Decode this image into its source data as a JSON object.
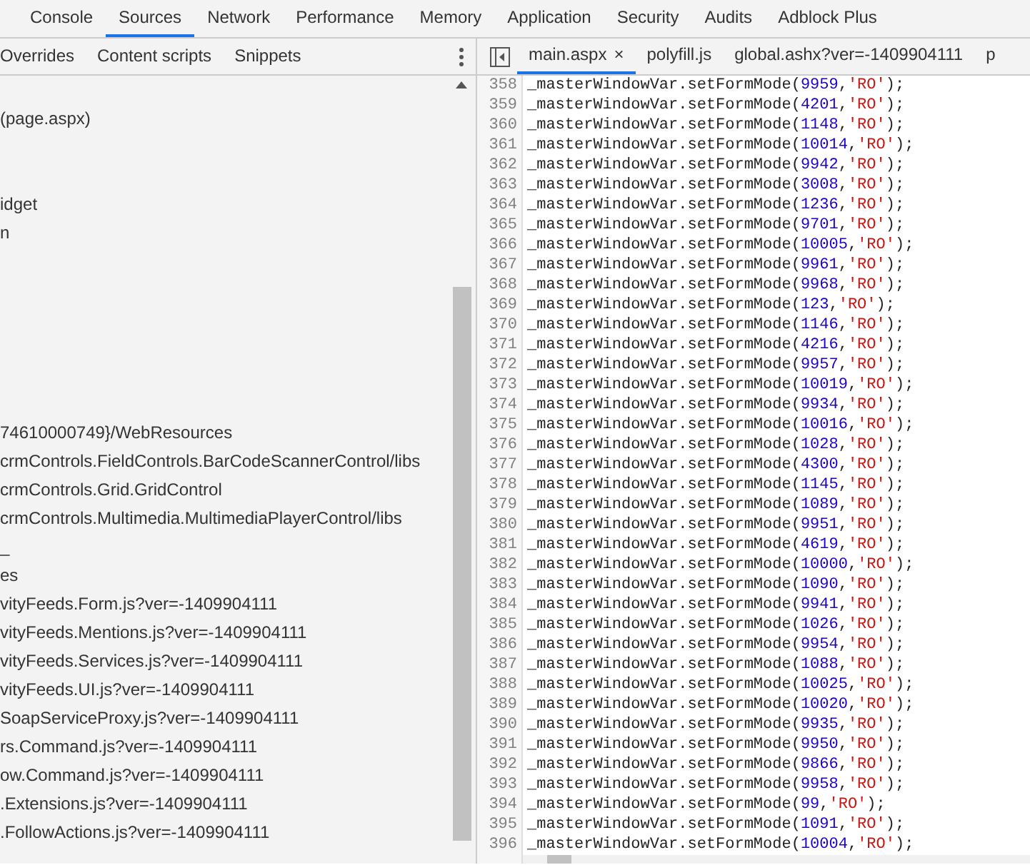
{
  "main_tabs": [
    {
      "label": "Console",
      "selected": false
    },
    {
      "label": "Sources",
      "selected": true
    },
    {
      "label": "Network",
      "selected": false
    },
    {
      "label": "Performance",
      "selected": false
    },
    {
      "label": "Memory",
      "selected": false
    },
    {
      "label": "Application",
      "selected": false
    },
    {
      "label": "Security",
      "selected": false
    },
    {
      "label": "Audits",
      "selected": false
    },
    {
      "label": "Adblock Plus",
      "selected": false
    }
  ],
  "navigator_tabs": [
    {
      "label": "Overrides"
    },
    {
      "label": "Content scripts"
    },
    {
      "label": "Snippets"
    }
  ],
  "editor_tabs": [
    {
      "label": "main.aspx",
      "selected": true,
      "close": "×"
    },
    {
      "label": "polyfill.js",
      "selected": false
    },
    {
      "label": "global.ashx?ver=-1409904111",
      "selected": false
    },
    {
      "label": "p",
      "selected": false
    }
  ],
  "file_tree": [
    {
      "kind": "item",
      "text": "(page.aspx)"
    },
    {
      "kind": "blank"
    },
    {
      "kind": "blank"
    },
    {
      "kind": "item",
      "text": "idget"
    },
    {
      "kind": "item",
      "text": "n"
    },
    {
      "kind": "blank"
    },
    {
      "kind": "blank"
    },
    {
      "kind": "blank"
    },
    {
      "kind": "blank"
    },
    {
      "kind": "blank"
    },
    {
      "kind": "blank"
    },
    {
      "kind": "item",
      "text": "74610000749}/WebResources"
    },
    {
      "kind": "item",
      "text": "crmControls.FieldControls.BarCodeScannerControl/libs"
    },
    {
      "kind": "item",
      "text": "crmControls.Grid.GridControl"
    },
    {
      "kind": "item",
      "text": "crmControls.Multimedia.MultimediaPlayerControl/libs"
    },
    {
      "kind": "item",
      "text": "_"
    },
    {
      "kind": "item",
      "text": "es"
    },
    {
      "kind": "item",
      "text": "vityFeeds.Form.js?ver=-1409904111"
    },
    {
      "kind": "item",
      "text": "vityFeeds.Mentions.js?ver=-1409904111"
    },
    {
      "kind": "item",
      "text": "vityFeeds.Services.js?ver=-1409904111"
    },
    {
      "kind": "item",
      "text": "vityFeeds.UI.js?ver=-1409904111"
    },
    {
      "kind": "item",
      "text": "SoapServiceProxy.js?ver=-1409904111"
    },
    {
      "kind": "item",
      "text": "rs.Command.js?ver=-1409904111"
    },
    {
      "kind": "item",
      "text": "ow.Command.js?ver=-1409904111"
    },
    {
      "kind": "item",
      "text": ".Extensions.js?ver=-1409904111"
    },
    {
      "kind": "item",
      "text": ".FollowActions.js?ver=-1409904111"
    }
  ],
  "code_lines": [
    {
      "n": "358",
      "call": "_masterWindowVar.setFormMode(",
      "arg": "9959",
      "mode": "'RO'"
    },
    {
      "n": "359",
      "call": "_masterWindowVar.setFormMode(",
      "arg": "4201",
      "mode": "'RO'"
    },
    {
      "n": "360",
      "call": "_masterWindowVar.setFormMode(",
      "arg": "1148",
      "mode": "'RO'"
    },
    {
      "n": "361",
      "call": "_masterWindowVar.setFormMode(",
      "arg": "10014",
      "mode": "'RO'"
    },
    {
      "n": "362",
      "call": "_masterWindowVar.setFormMode(",
      "arg": "9942",
      "mode": "'RO'"
    },
    {
      "n": "363",
      "call": "_masterWindowVar.setFormMode(",
      "arg": "3008",
      "mode": "'RO'"
    },
    {
      "n": "364",
      "call": "_masterWindowVar.setFormMode(",
      "arg": "1236",
      "mode": "'RO'"
    },
    {
      "n": "365",
      "call": "_masterWindowVar.setFormMode(",
      "arg": "9701",
      "mode": "'RO'"
    },
    {
      "n": "366",
      "call": "_masterWindowVar.setFormMode(",
      "arg": "10005",
      "mode": "'RO'"
    },
    {
      "n": "367",
      "call": "_masterWindowVar.setFormMode(",
      "arg": "9961",
      "mode": "'RO'"
    },
    {
      "n": "368",
      "call": "_masterWindowVar.setFormMode(",
      "arg": "9968",
      "mode": "'RO'"
    },
    {
      "n": "369",
      "call": "_masterWindowVar.setFormMode(",
      "arg": "123",
      "mode": "'RO'"
    },
    {
      "n": "370",
      "call": "_masterWindowVar.setFormMode(",
      "arg": "1146",
      "mode": "'RO'"
    },
    {
      "n": "371",
      "call": "_masterWindowVar.setFormMode(",
      "arg": "4216",
      "mode": "'RO'"
    },
    {
      "n": "372",
      "call": "_masterWindowVar.setFormMode(",
      "arg": "9957",
      "mode": "'RO'"
    },
    {
      "n": "373",
      "call": "_masterWindowVar.setFormMode(",
      "arg": "10019",
      "mode": "'RO'"
    },
    {
      "n": "374",
      "call": "_masterWindowVar.setFormMode(",
      "arg": "9934",
      "mode": "'RO'"
    },
    {
      "n": "375",
      "call": "_masterWindowVar.setFormMode(",
      "arg": "10016",
      "mode": "'RO'"
    },
    {
      "n": "376",
      "call": "_masterWindowVar.setFormMode(",
      "arg": "1028",
      "mode": "'RO'"
    },
    {
      "n": "377",
      "call": "_masterWindowVar.setFormMode(",
      "arg": "4300",
      "mode": "'RO'"
    },
    {
      "n": "378",
      "call": "_masterWindowVar.setFormMode(",
      "arg": "1145",
      "mode": "'RO'"
    },
    {
      "n": "379",
      "call": "_masterWindowVar.setFormMode(",
      "arg": "1089",
      "mode": "'RO'"
    },
    {
      "n": "380",
      "call": "_masterWindowVar.setFormMode(",
      "arg": "9951",
      "mode": "'RO'"
    },
    {
      "n": "381",
      "call": "_masterWindowVar.setFormMode(",
      "arg": "4619",
      "mode": "'RO'"
    },
    {
      "n": "382",
      "call": "_masterWindowVar.setFormMode(",
      "arg": "10000",
      "mode": "'RO'"
    },
    {
      "n": "383",
      "call": "_masterWindowVar.setFormMode(",
      "arg": "1090",
      "mode": "'RO'"
    },
    {
      "n": "384",
      "call": "_masterWindowVar.setFormMode(",
      "arg": "9941",
      "mode": "'RO'"
    },
    {
      "n": "385",
      "call": "_masterWindowVar.setFormMode(",
      "arg": "1026",
      "mode": "'RO'"
    },
    {
      "n": "386",
      "call": "_masterWindowVar.setFormMode(",
      "arg": "9954",
      "mode": "'RO'"
    },
    {
      "n": "387",
      "call": "_masterWindowVar.setFormMode(",
      "arg": "1088",
      "mode": "'RO'"
    },
    {
      "n": "388",
      "call": "_masterWindowVar.setFormMode(",
      "arg": "10025",
      "mode": "'RO'"
    },
    {
      "n": "389",
      "call": "_masterWindowVar.setFormMode(",
      "arg": "10020",
      "mode": "'RO'"
    },
    {
      "n": "390",
      "call": "_masterWindowVar.setFormMode(",
      "arg": "9935",
      "mode": "'RO'"
    },
    {
      "n": "391",
      "call": "_masterWindowVar.setFormMode(",
      "arg": "9950",
      "mode": "'RO'"
    },
    {
      "n": "392",
      "call": "_masterWindowVar.setFormMode(",
      "arg": "9866",
      "mode": "'RO'"
    },
    {
      "n": "393",
      "call": "_masterWindowVar.setFormMode(",
      "arg": "9958",
      "mode": "'RO'"
    },
    {
      "n": "394",
      "call": "_masterWindowVar.setFormMode(",
      "arg": "99",
      "mode": "'RO'"
    },
    {
      "n": "395",
      "call": "_masterWindowVar.setFormMode(",
      "arg": "1091",
      "mode": "'RO'"
    },
    {
      "n": "396",
      "call": "_masterWindowVar.setFormMode(",
      "arg": "10004",
      "mode": "'RO'"
    }
  ],
  "code_separators": {
    "comma": ",",
    "end": ");"
  }
}
